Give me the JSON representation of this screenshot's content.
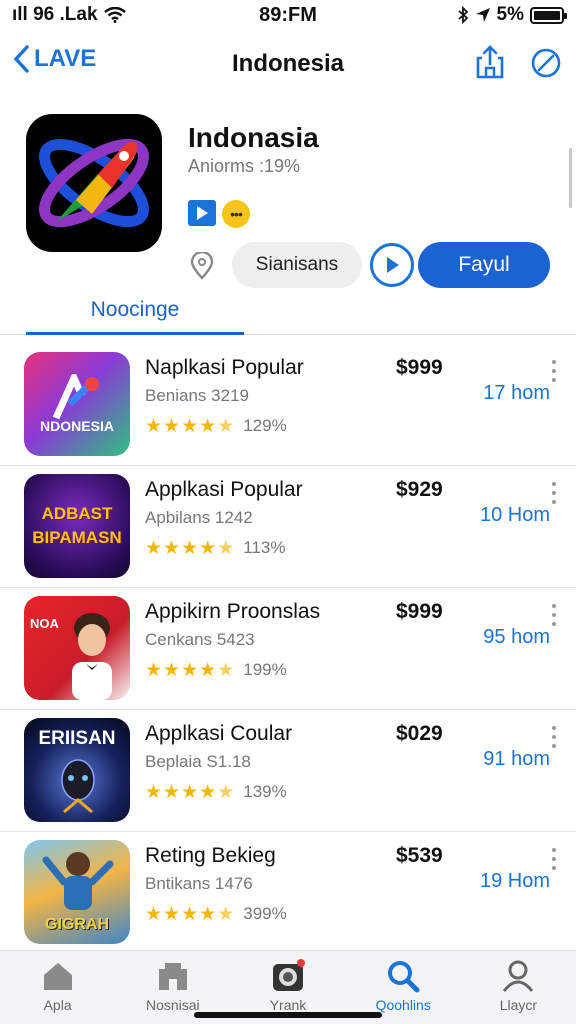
{
  "status": {
    "carrier": "ıll 96 .Lak",
    "time": "89:FM",
    "battery": "5%"
  },
  "nav": {
    "back_label": "LAVE",
    "title": "Indonesia"
  },
  "app": {
    "name": "Indonasia",
    "subtitle": "Aniorms :19%",
    "secondary_button": "Sianisans",
    "primary_button": "Fayul"
  },
  "tabs": {
    "active": "Noocinge"
  },
  "items": [
    {
      "title": "Naplkasi Popular",
      "subtitle": "Benians 3219",
      "rating": "129%",
      "price": "$999",
      "distance": "17 hom",
      "thumb_text": "NDONESIA",
      "stars": 4.5
    },
    {
      "title": "Applkasi Popular",
      "subtitle": "Apbilans 1242",
      "rating": "113%",
      "price": "$929",
      "distance": "10 Hom",
      "thumb_text": "ADBAST BIPAMASN",
      "stars": 4.5
    },
    {
      "title": "Appikirn Proonslas",
      "subtitle": "Cenkans 5423",
      "rating": "199%",
      "price": "$999",
      "distance": "95 hom",
      "thumb_text": "NOA",
      "stars": 4.5
    },
    {
      "title": "Applkasi Coular",
      "subtitle": "Beplaia S1.18",
      "rating": "139%",
      "price": "$029",
      "distance": "91 hom",
      "thumb_text": "ERIISAN",
      "stars": 4.5
    },
    {
      "title": "Reting Bekieg",
      "subtitle": "Bntikans 1476",
      "rating": "399%",
      "price": "$539",
      "distance": "19 Hom",
      "thumb_text": "GIGRAH",
      "stars": 4.5
    }
  ],
  "bottom_nav": [
    {
      "label": "Apla",
      "icon": "home-icon"
    },
    {
      "label": "Nosnisai",
      "icon": "store-icon"
    },
    {
      "label": "Yrank",
      "icon": "camera-icon"
    },
    {
      "label": "Qoohlins",
      "icon": "search-icon"
    },
    {
      "label": "Llaycr",
      "icon": "person-icon"
    }
  ],
  "colors": {
    "accent": "#1a73d9",
    "primary_button": "#1a63d0",
    "star": "#f2b705"
  }
}
